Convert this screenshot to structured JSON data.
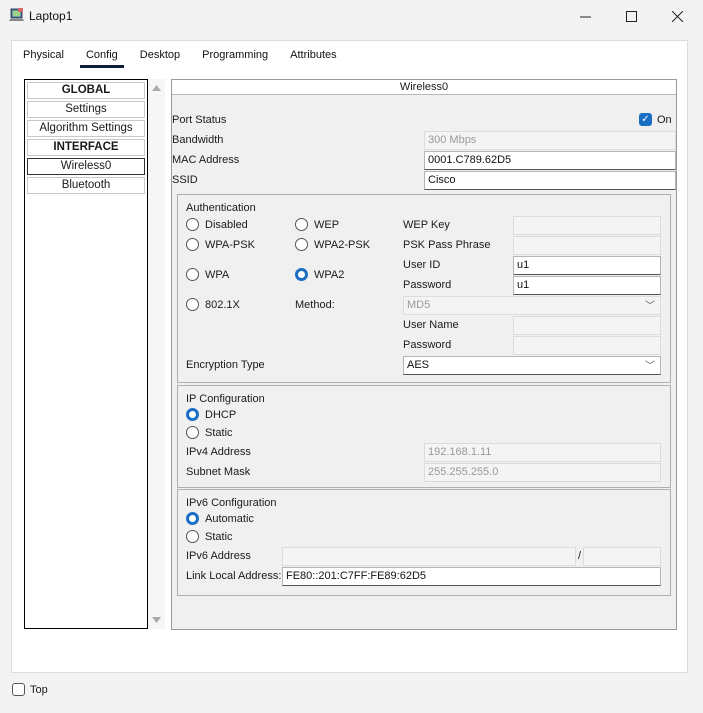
{
  "window": {
    "title": "Laptop1"
  },
  "tabs": [
    "Physical",
    "Config",
    "Desktop",
    "Programming",
    "Attributes"
  ],
  "active_tab": "Config",
  "sidebar": [
    "GLOBAL",
    "Settings",
    "Algorithm Settings",
    "INTERFACE",
    "Wireless0",
    "Bluetooth"
  ],
  "panel": {
    "title": "Wireless0",
    "port_status_label": "Port Status",
    "port_status_value": "On",
    "bandwidth_label": "Bandwidth",
    "bandwidth_value": "300 Mbps",
    "mac_label": "MAC Address",
    "mac_value": "0001.C789.62D5",
    "ssid_label": "SSID",
    "ssid_value": "Cisco"
  },
  "auth": {
    "title": "Authentication",
    "options": [
      "Disabled",
      "WEP",
      "WPA-PSK",
      "WPA2-PSK",
      "WPA",
      "WPA2",
      "802.1X"
    ],
    "selected": "WPA2",
    "method_label": "Method:",
    "method_value": "MD5",
    "wep_key_label": "WEP Key",
    "psk_label": "PSK Pass Phrase",
    "user_id_label": "User ID",
    "user_id_value": "u1",
    "password_label": "Password",
    "password_value": "u1",
    "user_name_label": "User Name",
    "password2_label": "Password",
    "encryption_label": "Encryption Type",
    "encryption_value": "AES"
  },
  "ip": {
    "title": "IP Configuration",
    "dhcp_label": "DHCP",
    "static_label": "Static",
    "ipv4_label": "IPv4 Address",
    "ipv4_value": "192.168.1.11",
    "mask_label": "Subnet Mask",
    "mask_value": "255.255.255.0"
  },
  "ipv6": {
    "title": "IPv6 Configuration",
    "auto_label": "Automatic",
    "static_label": "Static",
    "addr_label": "IPv6 Address",
    "slash": "/",
    "link_local_label": "Link Local Address:",
    "link_local_value": "FE80::201:C7FF:FE89:62D5"
  },
  "footer": {
    "top_label": "Top"
  }
}
